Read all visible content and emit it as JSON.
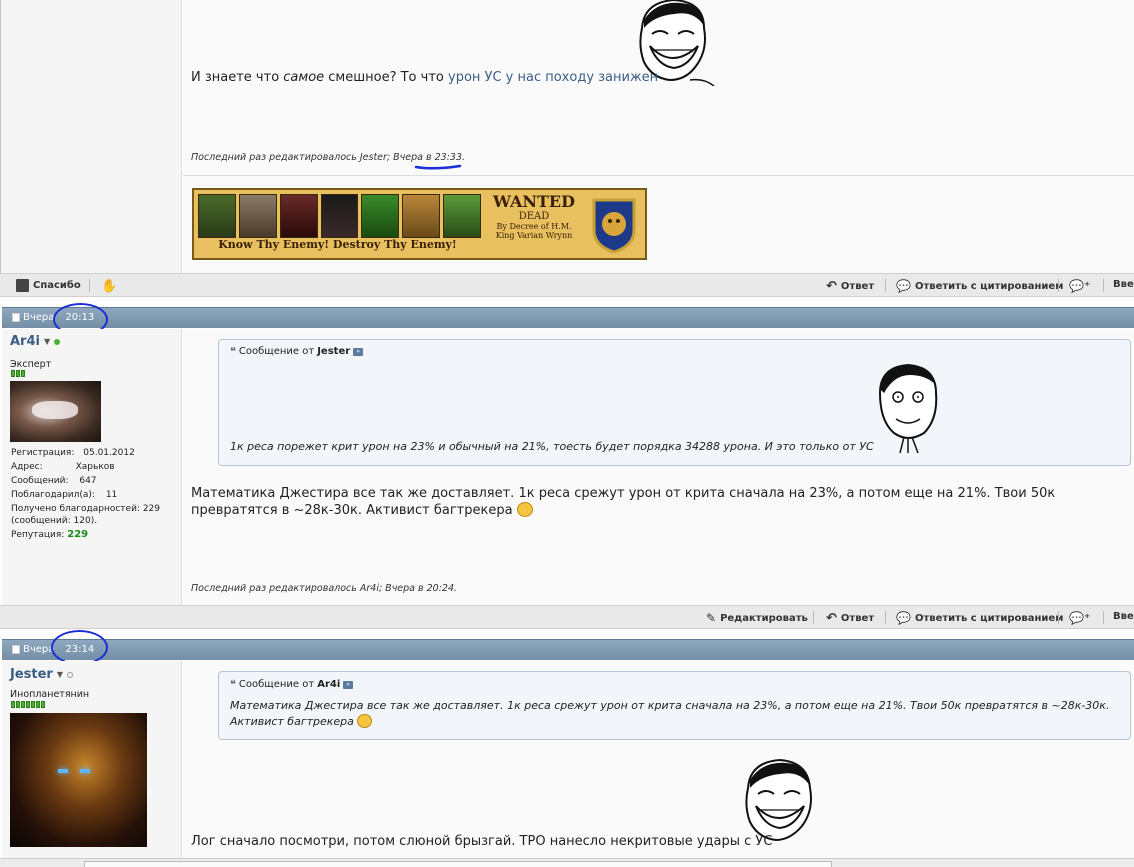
{
  "post1": {
    "text_prefix": "И знаете что ",
    "text_em": "самое",
    "text_mid": " смешное? То что ",
    "text_link": "урон УС у нас походу занижен",
    "edited": "Последний раз редактировалось Jester; Вчера в 23:33.",
    "banner": {
      "wanted": "WANTED",
      "dead": "DEAD",
      "decree": "By Decree of H.M.",
      "king": "King Varian Wrynn",
      "slogan": "Know Thy Enemy! Destroy Thy Enemy!"
    }
  },
  "bar1": {
    "thanks": "Спасибо",
    "reply": "Ответ",
    "reply_quote": "Ответить с цитированием",
    "more": "Вве"
  },
  "post2": {
    "date": "Вчера",
    "time": "20:13",
    "user": {
      "name": "Ar4i",
      "title": "Эксперт",
      "reg_label": "Регистрация:",
      "reg_value": "05.01.2012",
      "addr_label": "Адрес:",
      "addr_value": "Харьков",
      "msgs_label": "Сообщений:",
      "msgs_value": "647",
      "thanked_label": "Поблагодарил(а):",
      "thanked_value": "11",
      "got_thanks": "Получено благодарностей: 229",
      "got_thanks2": "(сообщений: 120).",
      "rep_label": "Репутация:",
      "rep_value": "229"
    },
    "quote_from": "Сообщение от",
    "quote_author": "Jester",
    "quote_text": "1к реса порежет крит урон на 23% и обычный на 21%, тоесть будет порядка 34288 урона. И это только от УС",
    "text": "Математика Джестира все так же доставляет. 1к реса срежут урон от крита сначала на 23%, а потом еще на 21%. Твои 50к превратятся в ~28к-30к. Активист багтрекера",
    "edited": "Последний раз редактировалось Ar4i; Вчера в 20:24."
  },
  "bar2": {
    "edit": "Редактировать",
    "reply": "Ответ",
    "reply_quote": "Ответить с цитированием",
    "more": "Вве"
  },
  "post3": {
    "date": "Вчера",
    "time": "23:14",
    "user": {
      "name": "Jester",
      "title": "Инопланетянин"
    },
    "quote_from": "Сообщение от",
    "quote_author": "Ar4i",
    "quote_text": "Математика Джестира все так же доставляет. 1к реса срежут урон от крита сначала на 23%, а потом еще на 21%. Твои 50к превратятся в ~28к-30к. Активист багтрекера",
    "text": "Лог сначало посмотри, потом слюной брызгай. ТРО нанесло некритовые удары с УС"
  },
  "colors": {
    "header": "#738ea6",
    "link": "#3a5e86",
    "annotation": "#1a2fd6",
    "rep_green": "#49b22f"
  }
}
